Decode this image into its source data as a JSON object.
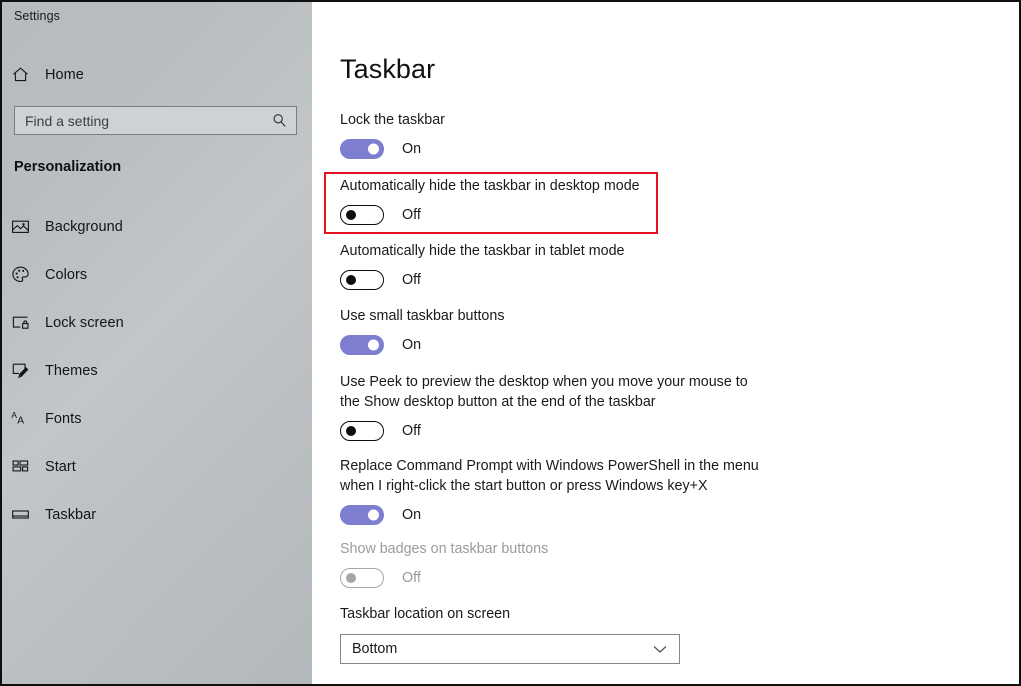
{
  "window": {
    "title": "Settings",
    "controls": [
      {
        "name": "minimize",
        "label": "—"
      },
      {
        "name": "maximize",
        "label": "□"
      },
      {
        "name": "close",
        "label": "✕"
      }
    ]
  },
  "sidebar": {
    "home_label": "Home",
    "home_icon": "home-icon",
    "search": {
      "placeholder": "Find a setting",
      "value": "",
      "icon": "search-icon"
    },
    "category": "Personalization",
    "items": [
      {
        "label": "Background",
        "icon": "image-icon",
        "selected": false
      },
      {
        "label": "Colors",
        "icon": "palette-icon",
        "selected": false
      },
      {
        "label": "Lock screen",
        "icon": "lock-screen-icon",
        "selected": false
      },
      {
        "label": "Themes",
        "icon": "brush-icon",
        "selected": false
      },
      {
        "label": "Fonts",
        "icon": "fonts-icon",
        "selected": false
      },
      {
        "label": "Start",
        "icon": "start-tiles-icon",
        "selected": false
      },
      {
        "label": "Taskbar",
        "icon": "taskbar-icon",
        "selected": false
      }
    ]
  },
  "main": {
    "title": "Taskbar",
    "settings": [
      {
        "label": "Lock the taskbar",
        "state": "On",
        "toggle": "on",
        "disabled": false,
        "highlighted": false
      },
      {
        "label": "Automatically hide the taskbar in desktop mode",
        "state": "Off",
        "toggle": "off",
        "disabled": false,
        "highlighted": true
      },
      {
        "label": "Automatically hide the taskbar in tablet mode",
        "state": "Off",
        "toggle": "off",
        "disabled": false,
        "highlighted": false
      },
      {
        "label": "Use small taskbar buttons",
        "state": "On",
        "toggle": "on",
        "disabled": false,
        "highlighted": false
      },
      {
        "label": "Use Peek to preview the desktop when you move your mouse to the Show desktop button at the end of the taskbar",
        "state": "Off",
        "toggle": "off",
        "disabled": false,
        "highlighted": false
      },
      {
        "label": "Replace Command Prompt with Windows PowerShell in the menu when I right-click the start button or press Windows key+X",
        "state": "On",
        "toggle": "on",
        "disabled": false,
        "highlighted": false
      },
      {
        "label": "Show badges on taskbar buttons",
        "state": "Off",
        "toggle": "disabled",
        "disabled": true,
        "highlighted": false
      }
    ],
    "location_setting": {
      "label": "Taskbar location on screen",
      "value": "Bottom",
      "chevron": "chevron-down-icon"
    }
  },
  "colors": {
    "accent_toggle_on": "#7d7ed0",
    "highlight_border": "#e81123",
    "sidebar_bg": "#bcc0c3",
    "main_bg": "#ffffff",
    "text": "#1a1a1a",
    "disabled_text": "#9b9b9b"
  }
}
